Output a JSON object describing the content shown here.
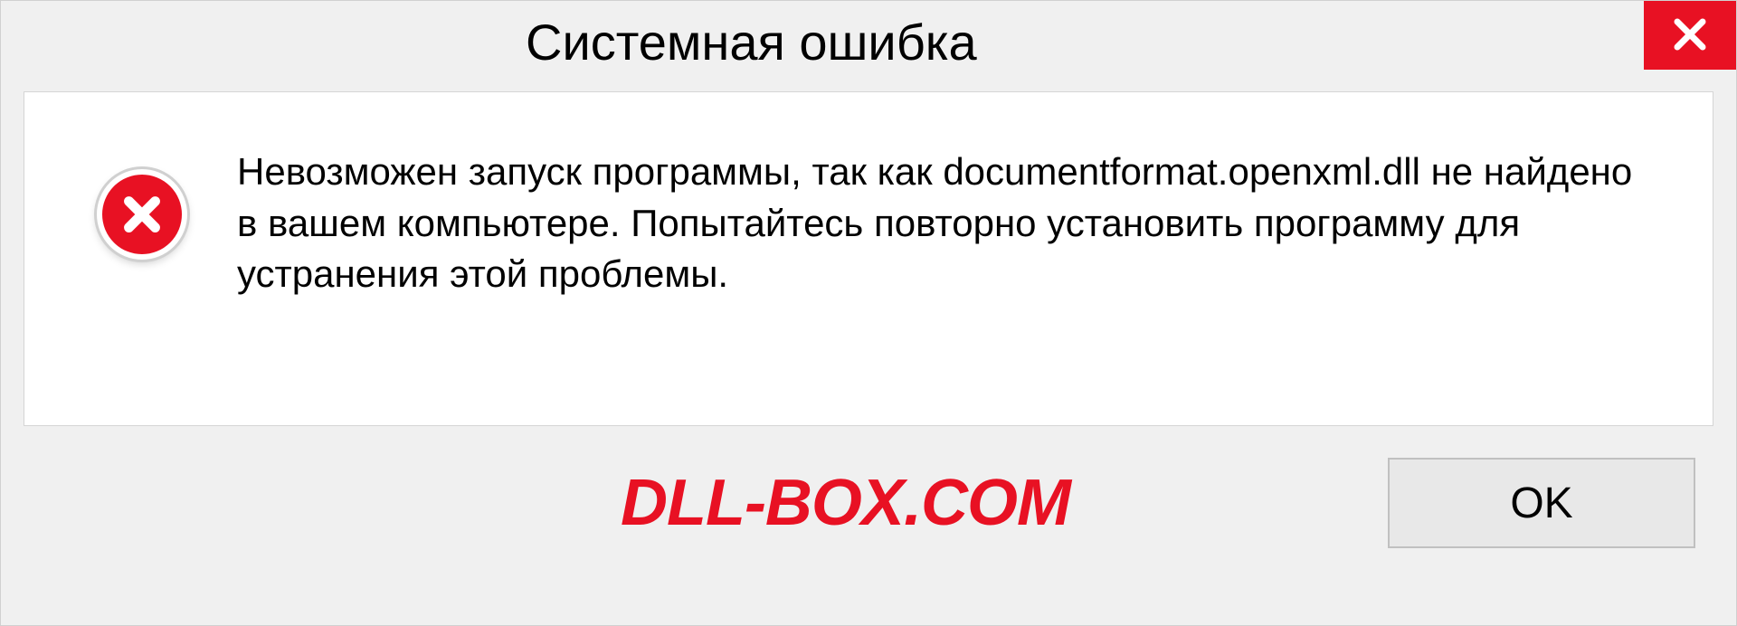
{
  "dialog": {
    "title": "Системная ошибка",
    "message": "Невозможен запуск программы, так как documentformat.openxml.dll  не найдено в вашем компьютере. Попытайтесь повторно установить программу для устранения этой проблемы.",
    "ok_label": "OK"
  },
  "watermark": "DLL-BOX.COM"
}
